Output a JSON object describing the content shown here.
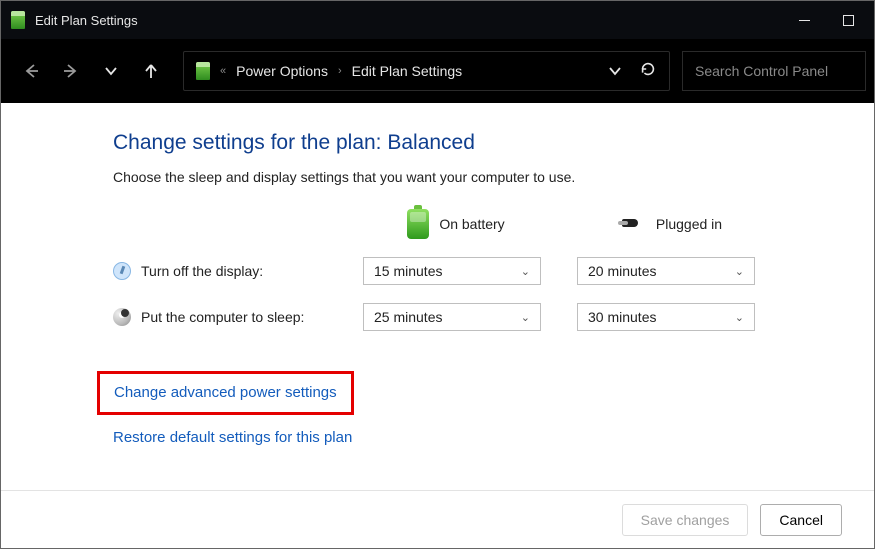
{
  "window": {
    "title": "Edit Plan Settings"
  },
  "breadcrumb": {
    "seg1": "Power Options",
    "seg2": "Edit Plan Settings"
  },
  "search": {
    "placeholder": "Search Control Panel"
  },
  "page": {
    "heading": "Change settings for the plan: Balanced",
    "desc": "Choose the sleep and display settings that you want your computer to use.",
    "col_battery": "On battery",
    "col_plugged": "Plugged in",
    "row_display": "Turn off the display:",
    "row_sleep": "Put the computer to sleep:",
    "display_battery": "15 minutes",
    "display_plugged": "20 minutes",
    "sleep_battery": "25 minutes",
    "sleep_plugged": "30 minutes",
    "link_advanced": "Change advanced power settings",
    "link_restore": "Restore default settings for this plan"
  },
  "footer": {
    "save": "Save changes",
    "cancel": "Cancel"
  }
}
